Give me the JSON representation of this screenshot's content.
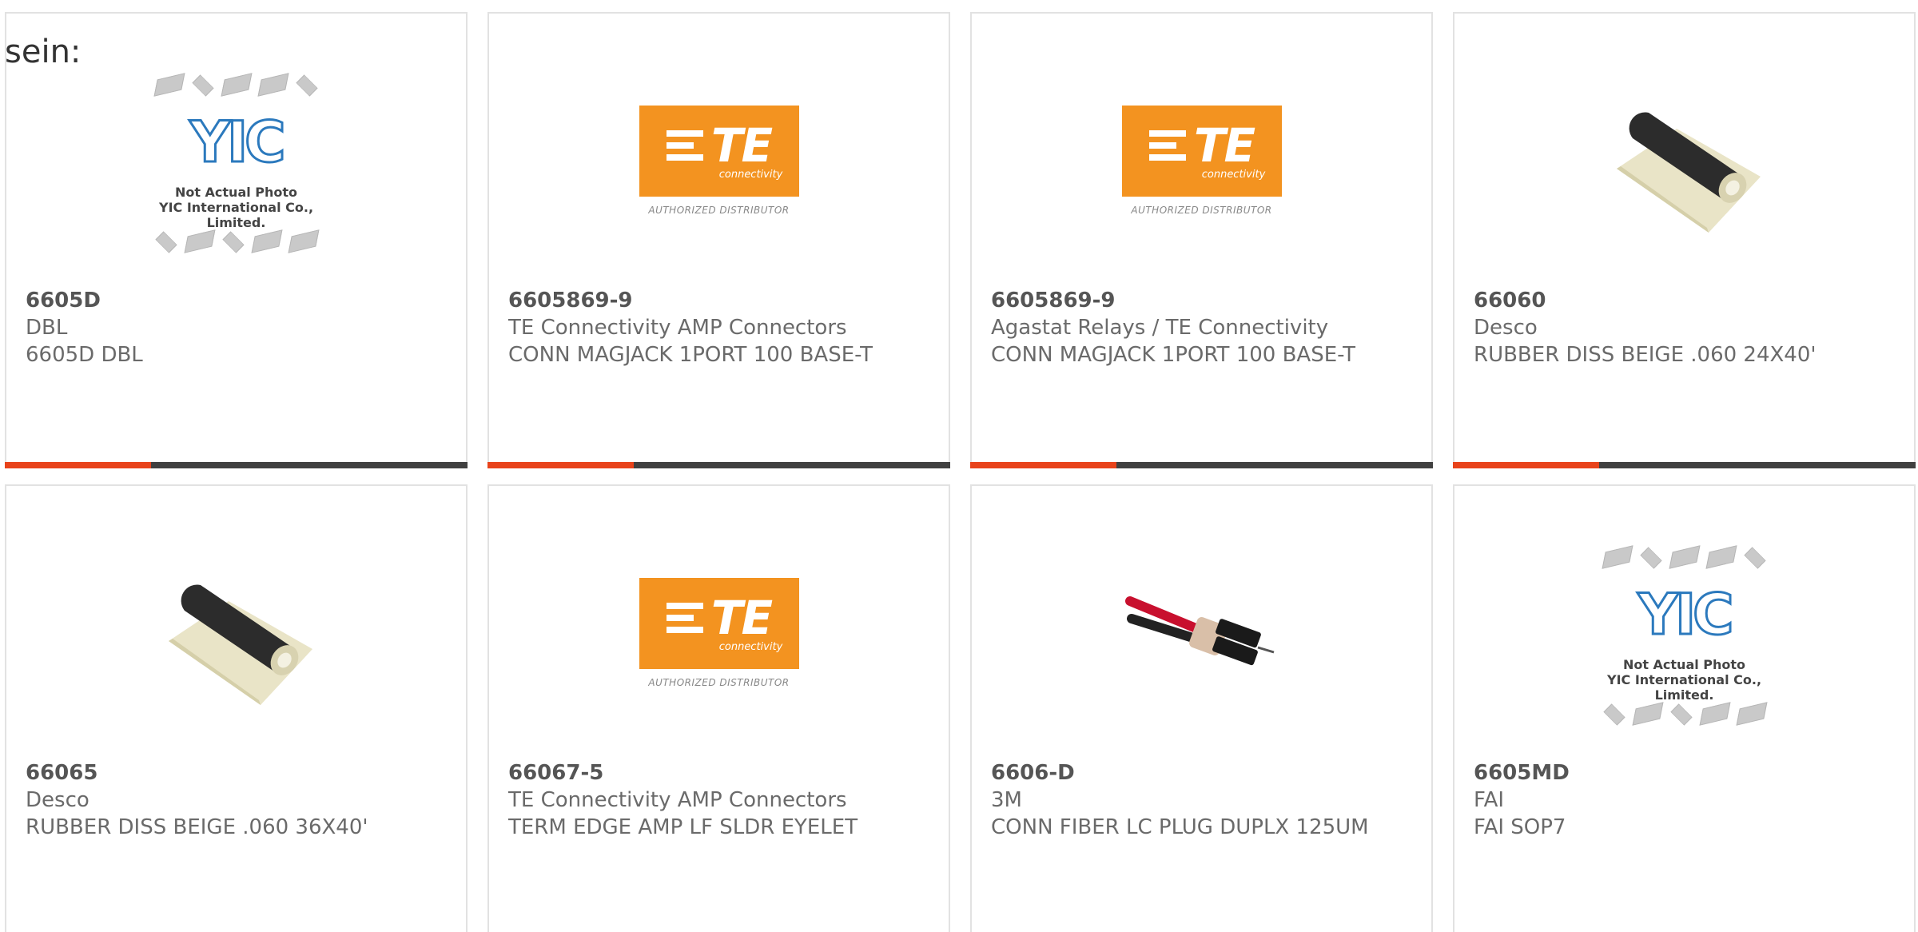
{
  "stray_text": "sein:",
  "placeholder": {
    "logo_text": "YIC",
    "caption_line1": "Not Actual Photo",
    "caption_line2": "YIC International Co., Limited."
  },
  "te_logo": {
    "brand": "TE",
    "sub": "connectivity",
    "distributor": "AUTHORIZED DISTRIBUTOR"
  },
  "colors": {
    "accent": "#e8431b",
    "bar_dark": "#404040",
    "te_orange": "#f39320",
    "yic_blue": "#2b79bd"
  },
  "products": [
    {
      "part_number": "6605D",
      "manufacturer": "DBL",
      "description": "6605D DBL",
      "image": "yic-placeholder"
    },
    {
      "part_number": "6605869-9",
      "manufacturer": "TE Connectivity AMP Connectors",
      "description": "CONN MAGJACK 1PORT 100 BASE-T",
      "image": "te-logo"
    },
    {
      "part_number": "6605869-9",
      "manufacturer": "Agastat Relays / TE Connectivity",
      "description": "CONN MAGJACK 1PORT 100 BASE-T",
      "image": "te-logo"
    },
    {
      "part_number": "66060",
      "manufacturer": "Desco",
      "description": "RUBBER DISS BEIGE .060 24X40'",
      "image": "rubber-mat-roll"
    },
    {
      "part_number": "66065",
      "manufacturer": "Desco",
      "description": "RUBBER DISS BEIGE .060 36X40'",
      "image": "rubber-mat-roll"
    },
    {
      "part_number": "66067-5",
      "manufacturer": "TE Connectivity AMP Connectors",
      "description": "TERM EDGE AMP LF SLDR EYELET",
      "image": "te-logo"
    },
    {
      "part_number": "6606-D",
      "manufacturer": "3M",
      "description": "CONN FIBER LC PLUG DUPLX 125UM",
      "image": "fiber-lc-connector"
    },
    {
      "part_number": "6605MD",
      "manufacturer": "FAI",
      "description": "FAI SOP7",
      "image": "yic-placeholder"
    }
  ]
}
